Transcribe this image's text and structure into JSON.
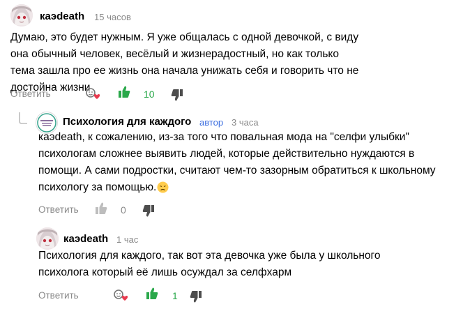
{
  "colors": {
    "like_active": "#2aa84a",
    "like_inactive": "#bdbdbd",
    "dislike": "#4d4d4d",
    "muted": "#8a8a8a",
    "author_badge": "#3d6fe0"
  },
  "comments": [
    {
      "author": "каэdeath",
      "time": "15 часов",
      "text": "Думаю, это будет нужным. Я уже общалась с одной девочкой, с виду она обычный человек, весёлый и жизнерадостный, но как только тема зашла про ее жизнь она начала унижать себя и говорить что не достойна жизни",
      "reply_label": "Ответить",
      "likes": "10",
      "liked": true,
      "icons": [
        "avatar",
        "reactions-icon",
        "like-icon",
        "dislike-icon"
      ]
    },
    {
      "author": "Психология для каждого",
      "badge": "автор",
      "time": "3 часа",
      "text": "каэdeath, к сожалению, из-за того что повальная мода на \"селфи улыбки\" психологам сложнее выявить людей, которые действительно нуждаются в помощи. А сами подростки, считают чем-то зазорным обратиться к школьному психологу за помощью.",
      "emoji": "sad-face-emoji",
      "reply_label": "Ответить",
      "likes": "0",
      "liked": false,
      "icons": [
        "avatar",
        "reply-arrow-icon",
        "like-icon",
        "dislike-icon"
      ]
    },
    {
      "author": "каэdeath",
      "time": "1 час",
      "text": "Психология для каждого, так вот эта девочка уже была у школьного психолога который её лишь осуждал за селфхарм",
      "reply_label": "Ответить",
      "likes": "1",
      "liked": true,
      "icons": [
        "avatar",
        "reactions-icon",
        "like-icon",
        "dislike-icon"
      ]
    }
  ]
}
